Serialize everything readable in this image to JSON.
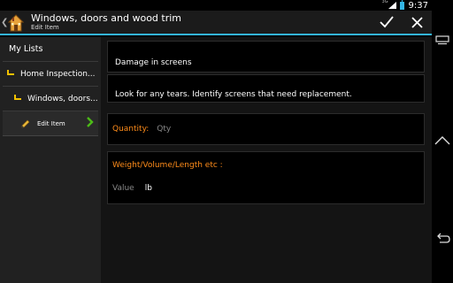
{
  "status_bar": {
    "network": "3G",
    "time": "9:37"
  },
  "action_bar": {
    "title": "Windows, doors and wood trim",
    "subtitle": "Edit Item",
    "icons": [
      "house-icon",
      "check-icon",
      "close-icon"
    ]
  },
  "sidebar": {
    "heading": "My Lists",
    "items": [
      {
        "label": "Home Inspection...",
        "icon": "level-arrow-icon"
      },
      {
        "label": "Windows, doors...",
        "icon": "level-arrow-icon"
      },
      {
        "label": "Edit Item",
        "icon": "pencil-icon",
        "selected": true
      }
    ]
  },
  "main": {
    "item_name": "Damage in screens",
    "description": "Look for any tears. Identify screens that need replacement.",
    "quantity": {
      "label": "Quantity:",
      "placeholder": "Qty"
    },
    "measure": {
      "label": "Weight/Volume/Length etc :",
      "value_placeholder": "Value",
      "unit": "lb"
    }
  },
  "colors": {
    "accent": "#33b5e5",
    "label_orange": "#ff8c1a",
    "chevron_green": "#4cbb17",
    "sidebar_bg": "#212121"
  }
}
